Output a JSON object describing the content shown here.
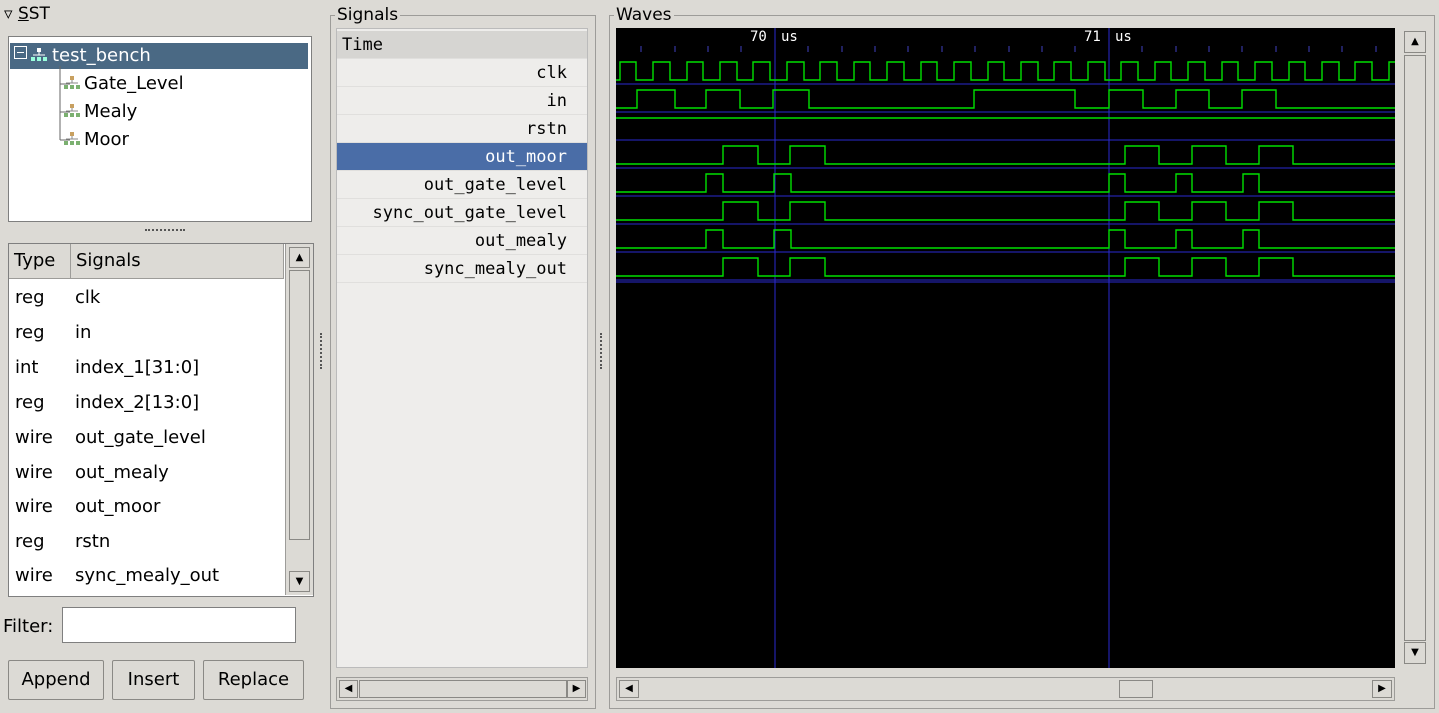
{
  "sst": {
    "title_prefix": "▿ ",
    "title_underlined": "S",
    "title_rest": "ST",
    "tree": [
      {
        "label": "test_bench",
        "level": 0,
        "selected": true
      },
      {
        "label": "Gate_Level",
        "level": 1
      },
      {
        "label": "Mealy",
        "level": 1
      },
      {
        "label": "Moor",
        "level": 1
      }
    ]
  },
  "signal_list": {
    "headers": {
      "type": "Type",
      "signals": "Signals"
    },
    "rows": [
      {
        "type": "reg",
        "name": "clk"
      },
      {
        "type": "reg",
        "name": "in"
      },
      {
        "type": "int",
        "name": "index_1[31:0]"
      },
      {
        "type": "reg",
        "name": "index_2[13:0]"
      },
      {
        "type": "wire",
        "name": "out_gate_level"
      },
      {
        "type": "wire",
        "name": "out_mealy"
      },
      {
        "type": "wire",
        "name": "out_moor"
      },
      {
        "type": "reg",
        "name": "rstn"
      },
      {
        "type": "wire",
        "name": "sync_mealy_out"
      }
    ]
  },
  "filter": {
    "label": "Filter:",
    "value": ""
  },
  "buttons": {
    "append": "Append",
    "insert": "Insert",
    "replace": "Replace"
  },
  "signals_panel": {
    "title": "Signals",
    "time_label": "Time",
    "rows": [
      "clk",
      "in",
      "rstn",
      "out_moor",
      "out_gate_level",
      "sync_out_gate_level",
      "out_mealy",
      "sync_mealy_out"
    ],
    "selected": "out_moor"
  },
  "waves": {
    "title": "Waves",
    "markers": [
      {
        "value": "70",
        "unit": "us"
      },
      {
        "value": "71",
        "unit": "us"
      }
    ],
    "colors": {
      "background": "#000000",
      "trace": "#00e000",
      "grid": "#2a2ad0",
      "text": "#ffffff"
    }
  },
  "colors": {
    "selection": "#4a6da7",
    "tree_selection": "#4a6984",
    "panel_bg": "#dcdad5"
  }
}
